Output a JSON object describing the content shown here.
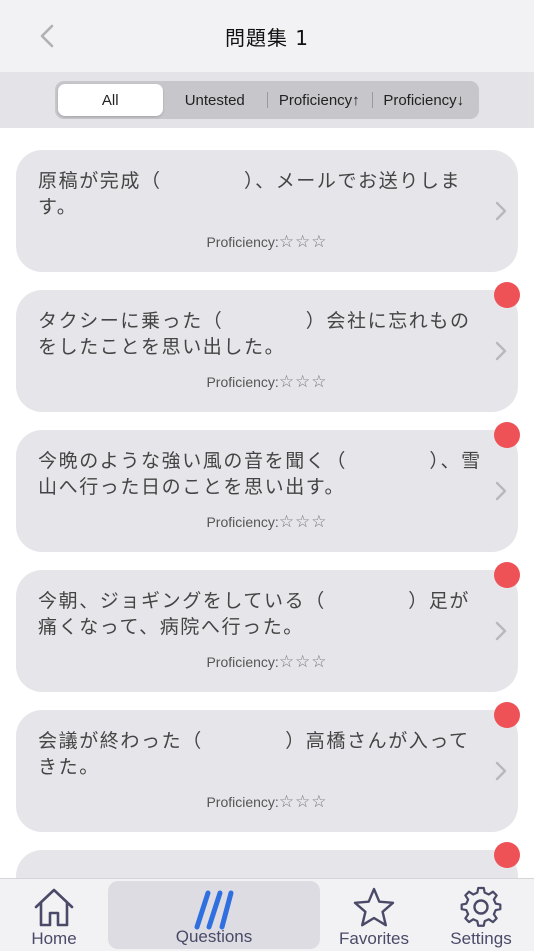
{
  "nav": {
    "title": "問題集 1"
  },
  "segments": [
    "All",
    "Untested",
    "Proficiency↑",
    "Proficiency↓"
  ],
  "active_segment": "All",
  "questions": [
    {
      "text": "原稿が完成（　　　　）、メールでお送りします。",
      "proficiency_label": "Proficiency:",
      "stars": "☆☆☆",
      "new": false
    },
    {
      "text": "タクシーに乗った（　　　　）会社に忘れものをしたことを思い出した。",
      "proficiency_label": "Proficiency:",
      "stars": "☆☆☆",
      "new": true
    },
    {
      "text": "今晩のような強い風の音を聞く（　　　　）、雪山へ行った日のことを思い出す。",
      "proficiency_label": "Proficiency:",
      "stars": "☆☆☆",
      "new": true
    },
    {
      "text": "今朝、ジョギングをしている（　　　　）足が痛くなって、病院へ行った。",
      "proficiency_label": "Proficiency:",
      "stars": "☆☆☆",
      "new": true
    },
    {
      "text": "会議が終わった（　　　　）高橋さんが入ってきた。",
      "proficiency_label": "Proficiency:",
      "stars": "☆☆☆",
      "new": true
    },
    {
      "text": "",
      "proficiency_label": "",
      "stars": "",
      "new": true
    }
  ],
  "tabs": [
    {
      "label": "Home",
      "icon": "home-icon"
    },
    {
      "label": "Questions",
      "icon": "questions-icon"
    },
    {
      "label": "Favorites",
      "icon": "star-icon"
    },
    {
      "label": "Settings",
      "icon": "gear-icon"
    }
  ],
  "active_tab": "Questions",
  "colors": {
    "accent_blue": "#2f6fe0",
    "badge_red": "#ee5256",
    "card_bg": "#e6e6ea",
    "tab_icon": "#4a4a68"
  }
}
